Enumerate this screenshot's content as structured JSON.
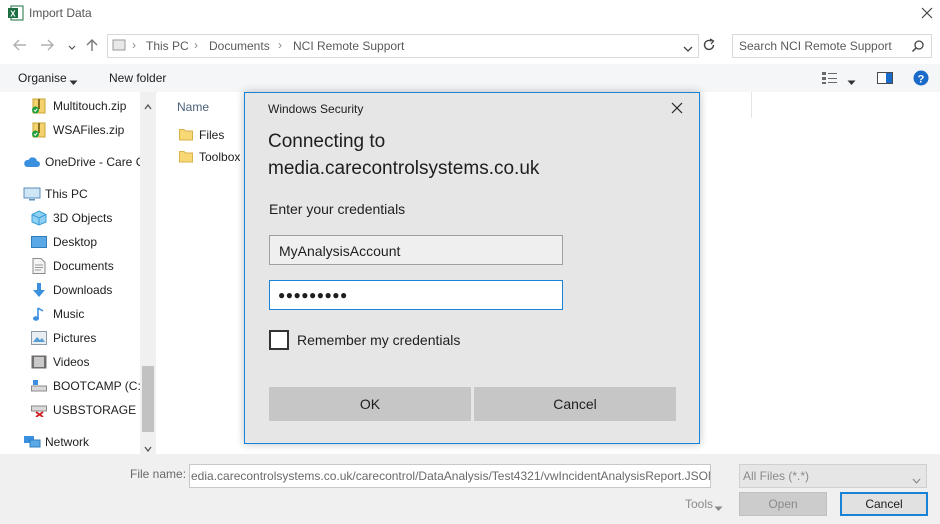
{
  "window": {
    "title": "Import Data"
  },
  "address": {
    "crumbs": [
      "This PC",
      "Documents",
      "NCI Remote Support"
    ],
    "search_placeholder": "Search NCI Remote Support"
  },
  "toolbar": {
    "organise": "Organise",
    "new_folder": "New folder"
  },
  "nav": {
    "items": [
      {
        "label": "Multitouch.zip",
        "icon": "zip-icon"
      },
      {
        "label": "WSAFiles.zip",
        "icon": "zip-icon"
      },
      {
        "label": "OneDrive - Care C",
        "icon": "cloud-icon"
      },
      {
        "label": "This PC",
        "icon": "computer-icon"
      },
      {
        "label": "3D Objects",
        "icon": "cube-icon"
      },
      {
        "label": "Desktop",
        "icon": "desktop-icon"
      },
      {
        "label": "Documents",
        "icon": "document-icon"
      },
      {
        "label": "Downloads",
        "icon": "download-icon"
      },
      {
        "label": "Music",
        "icon": "music-icon"
      },
      {
        "label": "Pictures",
        "icon": "picture-icon"
      },
      {
        "label": "Videos",
        "icon": "video-icon"
      },
      {
        "label": "BOOTCAMP (C:)",
        "icon": "drive-icon"
      },
      {
        "label": "USBSTORAGE (\\\\",
        "icon": "network-drive-icon"
      },
      {
        "label": "Network",
        "icon": "network-icon"
      }
    ]
  },
  "files": {
    "column_name": "Name",
    "items": [
      {
        "label": "Files",
        "icon": "folder-icon"
      },
      {
        "label": "Toolbox",
        "icon": "folder-icon"
      }
    ]
  },
  "bottom": {
    "file_name_label": "File name:",
    "file_name_value": "edia.carecontrolsystems.co.uk/carecontrol/DataAnalysis/Test4321/vwIncidentAnalysisReport.JSON",
    "file_type": "All Files (*.*)",
    "tools": "Tools",
    "open": "Open",
    "cancel": "Cancel"
  },
  "dialog": {
    "title": "Windows Security",
    "heading_line1": "Connecting to",
    "heading_line2": "media.carecontrolsystems.co.uk",
    "prompt": "Enter your credentials",
    "username": "MyAnalysisAccount",
    "password_mask": "●●●●●●●●●",
    "remember_label": "Remember my credentials",
    "ok": "OK",
    "cancel": "Cancel"
  },
  "colors": {
    "accent": "#1883d7",
    "excel_green": "#1d6f42",
    "help_blue": "#1a6ac9"
  }
}
